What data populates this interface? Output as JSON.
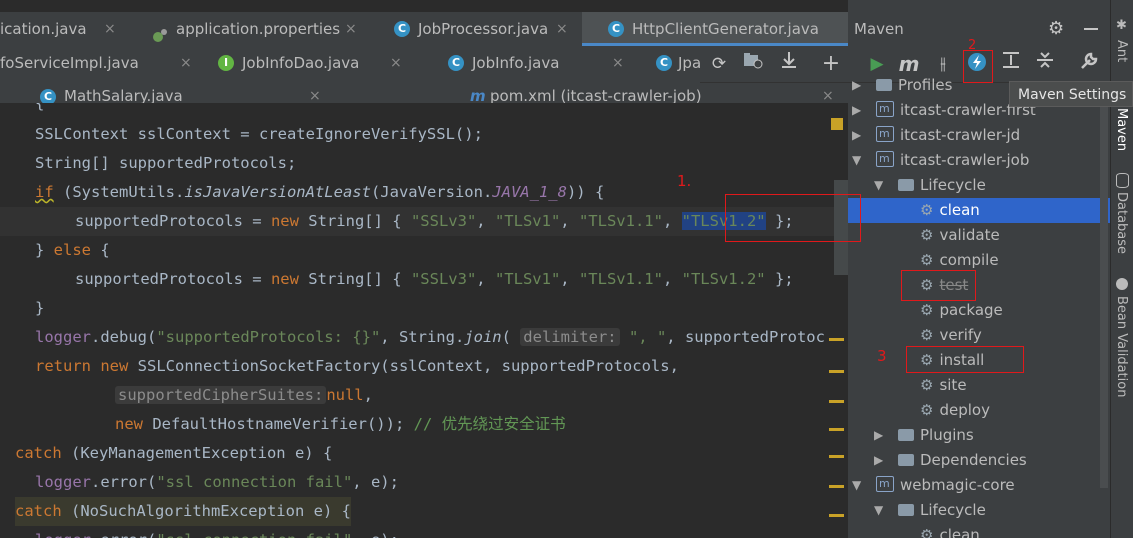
{
  "editor_tabs_row1": [
    {
      "label": "ication.java",
      "icon": "java-class-icon",
      "left": 0
    },
    {
      "label": "application.properties",
      "icon": "properties-icon"
    },
    {
      "label": "JobProcessor.java",
      "icon": "java-class-icon"
    },
    {
      "label": "HttpClientGenerator.java",
      "icon": "java-class-icon",
      "active": true
    }
  ],
  "editor_tabs_row2": [
    {
      "label": "foServiceImpl.java"
    },
    {
      "label": "JobInfoDao.java",
      "icon_letter": "I"
    },
    {
      "label": "JobInfo.java",
      "icon_letter": "C"
    },
    {
      "label": "Jpa",
      "icon_letter": "C"
    }
  ],
  "editor_tabs_row3": [
    {
      "label": "MathSalary.java",
      "icon_letter": "C"
    },
    {
      "label": "pom.xml (itcast-crawler-job)",
      "icon_letter": "m"
    }
  ],
  "close_glyph": "×",
  "code": {
    "l1a": "SSLContext sslContext = createIgnoreVerifySSL();",
    "l2a": "String[] supportedProtocols;",
    "l3_if": "if",
    "l3_b": " (SystemUtils.",
    "l3_fn": "isJavaVersionAtLeast",
    "l3_c": "(JavaVersion.",
    "l3_const": "JAVA_1_8",
    "l3_d": ")) {",
    "l4_a": "supportedProtocols = ",
    "l4_new": "new",
    "l4_b": " String[] { ",
    "l4_s1": "\"SSLv3\"",
    "l4_s2": "\"TLSv1\"",
    "l4_s3": "\"TLSv1.1\"",
    "l4_s4": "\"TLSv1.2\"",
    "l4_end": " };",
    "comma": ", ",
    "l5_a": "} ",
    "l5_else": "else",
    "l5_b": " {",
    "l7": "}",
    "l8_a": "logger",
    "l8_b": ".debug(",
    "l8_s": "\"supportedProtocols: {}\"",
    "l8_c": ", String.",
    "l8_join": "join",
    "l8_d": "( ",
    "l8_hint": "delimiter:",
    "l8_s2": " \", \"",
    "l8_e": ", supportedProtoc",
    "l9_ret": "return",
    "l9_new": "new",
    "l9_b": " SSLConnectionSocketFactory(sslContext, supportedProtocols,",
    "l10_hint": "supportedCipherSuites:",
    "l10_null": "null",
    "l10_end": ",",
    "l11_new": "new",
    "l11_b": " DefaultHostnameVerifier()); ",
    "l11_cm": "// 优先绕过安全证书",
    "l12_catch": "catch",
    "l12_b": " (KeyManagementException e) {",
    "l13_a": "logger",
    "l13_b": ".error(",
    "l13_s": "\"ssl connection fail\"",
    "l13_c": ", e);",
    "l14_catch": "catch",
    "l14_b": " (NoSuchAlgorithmException e) {",
    "brace_top": "{"
  },
  "maven": {
    "title": "Maven",
    "tooltip": "Maven Settings",
    "tree": [
      {
        "label": "Profiles"
      },
      {
        "label": "itcast-crawler-first"
      },
      {
        "label": "itcast-crawler-jd"
      },
      {
        "label": "itcast-crawler-job"
      },
      {
        "label": "Lifecycle"
      },
      {
        "label": "clean"
      },
      {
        "label": "validate"
      },
      {
        "label": "compile"
      },
      {
        "label": "test"
      },
      {
        "label": "package"
      },
      {
        "label": "verify"
      },
      {
        "label": "install"
      },
      {
        "label": "site"
      },
      {
        "label": "deploy"
      },
      {
        "label": "Plugins"
      },
      {
        "label": "Dependencies"
      },
      {
        "label": "webmagic-core"
      },
      {
        "label": "Lifecycle"
      },
      {
        "label": "clean"
      }
    ]
  },
  "side_tools": [
    "Ant",
    "Maven",
    "Database",
    "Bean Validation"
  ],
  "annotations": {
    "n1": "1.",
    "n2": "2",
    "n3": "3"
  },
  "toolbar": {
    "refresh": "⟳",
    "add": "+",
    "run": "▶",
    "m": "m",
    "skip": "⫲",
    "settings": "⚡",
    "expand": "⇕",
    "collapse": "⇔",
    "wrench": "🔧"
  }
}
